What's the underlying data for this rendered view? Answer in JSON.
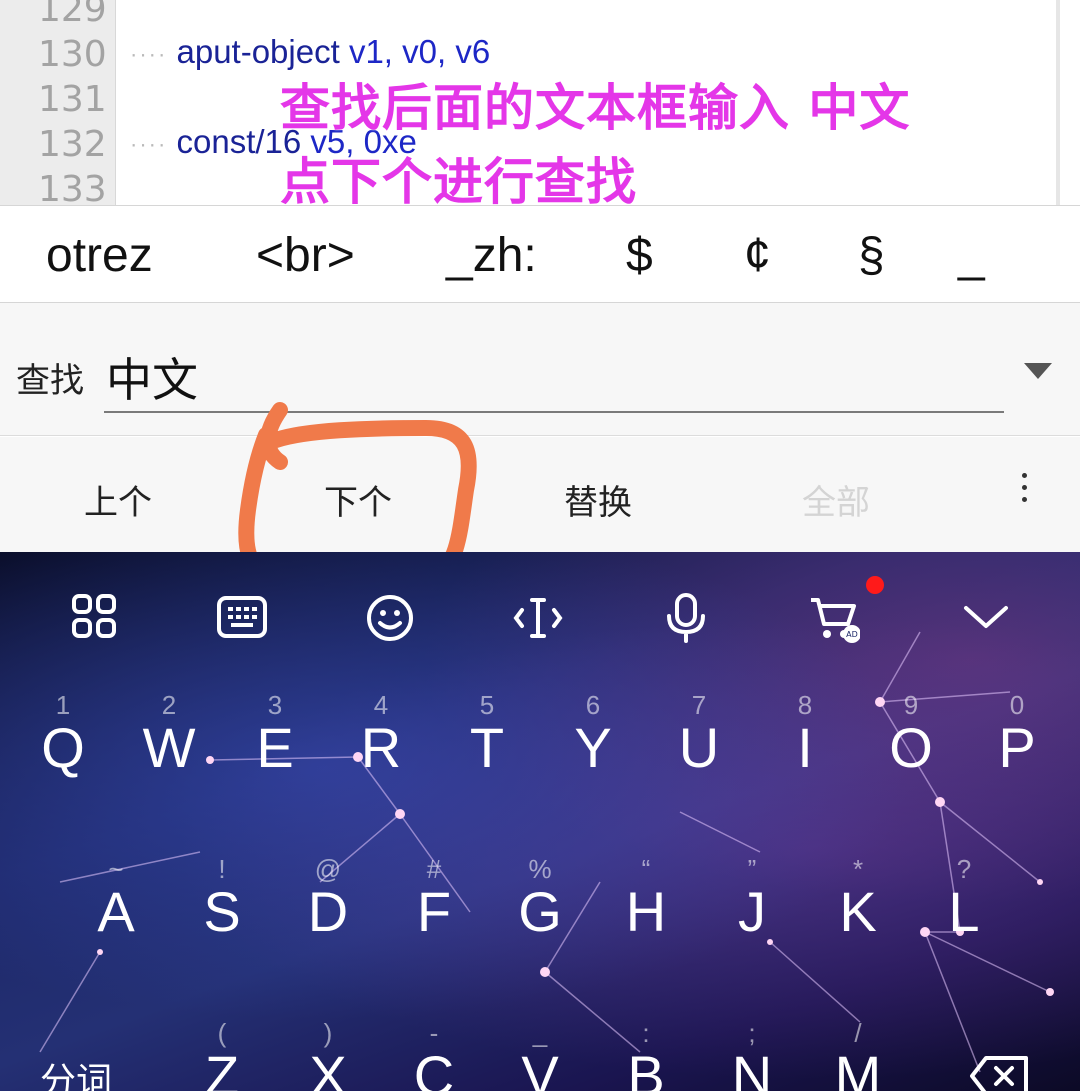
{
  "editor": {
    "line_numbers": [
      "129",
      "130",
      "131",
      "132",
      "133"
    ],
    "lines": [
      {
        "indent": "····",
        "opcode": "aput-object",
        "args": "v1, v0, v6"
      },
      {
        "indent": "",
        "opcode": "",
        "args": ""
      },
      {
        "indent": "····",
        "opcode": "const/16",
        "args": "v5, 0xe"
      }
    ],
    "overlay_line1": "查找后面的文本框输入 中文",
    "overlay_line2": "点下个进行查找"
  },
  "symbol_bar": [
    "otrez",
    "<br>",
    "_zh:",
    "$",
    "¢",
    "§",
    "_"
  ],
  "find": {
    "label": "查找",
    "value": "中文"
  },
  "actions": {
    "prev": "上个",
    "next": "下个",
    "replace": "替换",
    "all": "全部"
  },
  "keyboard": {
    "toolbar_icons": [
      "apps-grid-icon",
      "keyboard-icon",
      "emoji-icon",
      "cursor-icon",
      "microphone-icon",
      "cart-ad-icon",
      "collapse-chevron-icon"
    ],
    "toolbar_badge_color": "#ff1a1a",
    "row1": [
      {
        "hint": "1",
        "key": "Q"
      },
      {
        "hint": "2",
        "key": "W"
      },
      {
        "hint": "3",
        "key": "E"
      },
      {
        "hint": "4",
        "key": "R"
      },
      {
        "hint": "5",
        "key": "T"
      },
      {
        "hint": "6",
        "key": "Y"
      },
      {
        "hint": "7",
        "key": "U"
      },
      {
        "hint": "8",
        "key": "I"
      },
      {
        "hint": "9",
        "key": "O"
      },
      {
        "hint": "0",
        "key": "P"
      }
    ],
    "row2": [
      {
        "hint": "~",
        "key": "A"
      },
      {
        "hint": "!",
        "key": "S"
      },
      {
        "hint": "@",
        "key": "D"
      },
      {
        "hint": "#",
        "key": "F"
      },
      {
        "hint": "%",
        "key": "G"
      },
      {
        "hint": "“",
        "key": "H"
      },
      {
        "hint": "”",
        "key": "J"
      },
      {
        "hint": "*",
        "key": "K"
      },
      {
        "hint": "?",
        "key": "L"
      }
    ],
    "row3": [
      {
        "hint": "(",
        "key": "Z"
      },
      {
        "hint": ")",
        "key": "X"
      },
      {
        "hint": "-",
        "key": "C"
      },
      {
        "hint": "_",
        "key": "V"
      },
      {
        "hint": ":",
        "key": "B"
      },
      {
        "hint": ";",
        "key": "N"
      },
      {
        "hint": "/",
        "key": "M"
      }
    ],
    "segment_label": "分词"
  },
  "colors": {
    "overlay_text": "#e436e8",
    "annotation_stroke": "#f07a4a",
    "code_text": "#1a2396"
  }
}
